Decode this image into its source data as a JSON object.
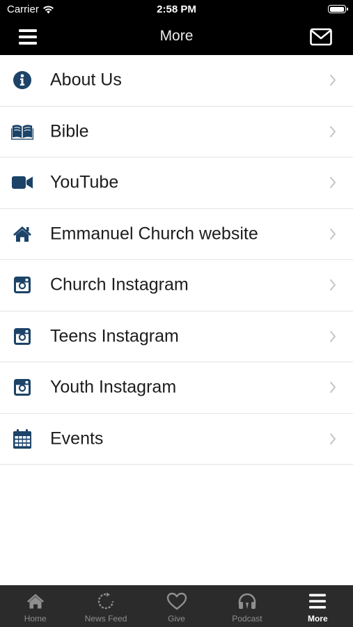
{
  "status_bar": {
    "carrier": "Carrier",
    "time": "2:58 PM"
  },
  "nav_bar": {
    "title": "More",
    "left_icon": "hamburger-menu-icon",
    "right_icon": "envelope-icon"
  },
  "colors": {
    "accent": "#1c4368",
    "nav_background": "#000000",
    "tab_background": "#2b2b2b",
    "tab_active": "#ffffff",
    "tab_inactive": "#8f8f8f"
  },
  "menu_items": [
    {
      "label": "About Us",
      "icon": "info-icon"
    },
    {
      "label": "Bible",
      "icon": "open-book-icon"
    },
    {
      "label": "YouTube",
      "icon": "video-camera-icon"
    },
    {
      "label": "Emmanuel Church website",
      "icon": "home-icon"
    },
    {
      "label": "Church Instagram",
      "icon": "instagram-icon"
    },
    {
      "label": "Teens Instagram",
      "icon": "instagram-icon"
    },
    {
      "label": "Youth Instagram",
      "icon": "instagram-icon"
    },
    {
      "label": "Events",
      "icon": "calendar-icon"
    }
  ],
  "tab_bar": {
    "active": "More",
    "tabs": [
      {
        "label": "Home",
        "icon": "home-icon"
      },
      {
        "label": "News Feed",
        "icon": "refresh-icon"
      },
      {
        "label": "Give",
        "icon": "heart-icon"
      },
      {
        "label": "Podcast",
        "icon": "headphones-icon"
      },
      {
        "label": "More",
        "icon": "hamburger-menu-icon"
      }
    ]
  }
}
